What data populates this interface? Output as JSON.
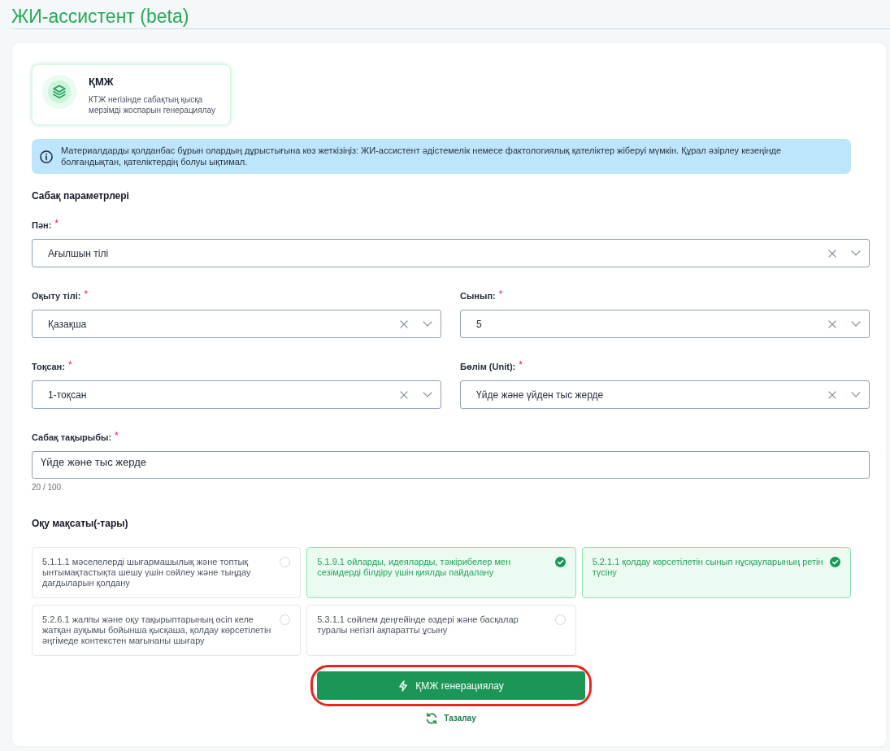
{
  "page": {
    "title": "ЖИ-ассистент (beta)"
  },
  "tool_card": {
    "title": "ҚМЖ",
    "description": "КТЖ негізінде сабақтың қысқа мерзімді жоспарын генерациялау",
    "selected": true
  },
  "alert": {
    "text": "Материалдарды қолданбас бұрын олардың дұрыстығына көз жеткізіңіз: ЖИ-ассистент әдістемелік немесе фактологиялық қателіктер жіберуі мүмкін. Құрал әзірлеу кезеңінде болғандықтан, қателіктердің болуы ықтимал."
  },
  "parameters": {
    "title": "Сабақ параметрлері",
    "rows": [
      {
        "fields": [
          {
            "kind": "select",
            "label": "Пән:",
            "required_mark": "*",
            "value": "Ағылшын тілі"
          }
        ]
      },
      {
        "fields": [
          {
            "kind": "select",
            "label": "Оқыту тілі:",
            "required_mark": "*",
            "value": "Қазақша"
          },
          {
            "kind": "select",
            "label": "Сынып:",
            "required_mark": "*",
            "value": "5"
          }
        ]
      },
      {
        "fields": [
          {
            "kind": "select",
            "label": "Тоқсан:",
            "required_mark": "*",
            "value": "1-тоқсан"
          },
          {
            "kind": "select",
            "label": "Бөлім (Unit):",
            "required_mark": "*",
            "value": "Үйде және үйден тыс жерде"
          }
        ]
      },
      {
        "fields": [
          {
            "kind": "text",
            "label": "Сабақ тақырыбы:",
            "required_mark": "*",
            "value": "Үйде және тыс жерде",
            "counter": "20 / 100"
          }
        ]
      }
    ]
  },
  "objectives": {
    "title": "Оқу мақсаты(-тары)",
    "items": [
      {
        "text": "5.1.1.1 мәселелерді шығармашылық және топтық ынтымақтастықта шешу үшін сөйлеу және тыңдау дағдыларын қолдану",
        "selected": false
      },
      {
        "text": "5.1.9.1 ойларды, идеяларды, тәжірибелер мен сезімдерді білдіру үшін қиялды пайдалану",
        "selected": true
      },
      {
        "text": "5.2.1.1 қолдау көрсетілетін сынып нұсқауларының ретін түсіну",
        "selected": true
      },
      {
        "text": "5.2.6.1 жалпы және оқу тақырыптарының өсіп келе жатқан ауқымы бойынша қысқаша, қолдау көрсетілетін әңгімеде контекстен мағынаны шығару",
        "selected": false
      },
      {
        "text": "5.3.1.1 сөйлем деңгейінде өздері және басқалар туралы негізгі ақпаратты ұсыну",
        "selected": false
      }
    ]
  },
  "generate_button": {
    "label": "ҚМЖ генерациялау",
    "highlighted": true
  },
  "reset_link": {
    "label": "Тазалау"
  }
}
